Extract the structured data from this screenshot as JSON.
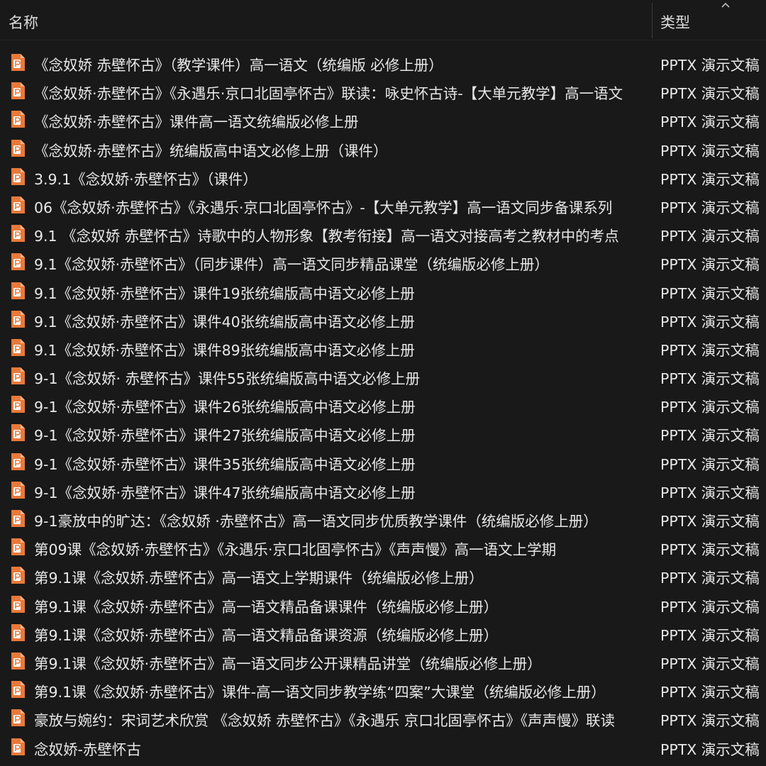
{
  "header": {
    "name_label": "名称",
    "type_label": "类型",
    "sort_icon": "chevron-up-icon"
  },
  "colors": {
    "background": "#191919",
    "text": "#e8e8e8",
    "icon_orange": "#e8793a"
  },
  "files": [
    {
      "name": "《念奴娇 赤壁怀古》（教学课件）高一语文（统编版 必修上册）",
      "type": "PPTX 演示文稿"
    },
    {
      "name": "《念奴娇·赤壁怀古》《永遇乐·京口北固亭怀古》联读：咏史怀古诗-【大单元教学】高一语文",
      "type": "PPTX 演示文稿"
    },
    {
      "name": "《念奴娇·赤壁怀古》课件高一语文统编版必修上册",
      "type": "PPTX 演示文稿"
    },
    {
      "name": "《念奴娇·赤壁怀古》统编版高中语文必修上册（课件）",
      "type": "PPTX 演示文稿"
    },
    {
      "name": "3.9.1《念奴娇·赤壁怀古》（课件）",
      "type": "PPTX 演示文稿"
    },
    {
      "name": "06《念奴娇·赤壁怀古》《永遇乐·京口北固亭怀古》-【大单元教学】高一语文同步备课系列",
      "type": "PPTX 演示文稿"
    },
    {
      "name": "9.1 《念奴娇  赤壁怀古》诗歌中的人物形象【教考衔接】高一语文对接高考之教材中的考点",
      "type": "PPTX 演示文稿"
    },
    {
      "name": "9.1《念奴娇·赤壁怀古》（同步课件）高一语文同步精品课堂（统编版必修上册）",
      "type": "PPTX 演示文稿"
    },
    {
      "name": "9.1《念奴娇·赤壁怀古》课件19张统编版高中语文必修上册",
      "type": "PPTX 演示文稿"
    },
    {
      "name": "9.1《念奴娇·赤壁怀古》课件40张统编版高中语文必修上册",
      "type": "PPTX 演示文稿"
    },
    {
      "name": "9.1《念奴娇·赤壁怀古》课件89张统编版高中语文必修上册",
      "type": "PPTX 演示文稿"
    },
    {
      "name": "9-1《念奴娇· 赤壁怀古》课件55张统编版高中语文必修上册",
      "type": "PPTX 演示文稿"
    },
    {
      "name": "9-1《念奴娇·赤壁怀古》课件26张统编版高中语文必修上册",
      "type": "PPTX 演示文稿"
    },
    {
      "name": "9-1《念奴娇·赤壁怀古》课件27张统编版高中语文必修上册",
      "type": "PPTX 演示文稿"
    },
    {
      "name": "9-1《念奴娇·赤壁怀古》课件35张统编版高中语文必修上册",
      "type": "PPTX 演示文稿"
    },
    {
      "name": "9-1《念奴娇·赤壁怀古》课件47张统编版高中语文必修上册",
      "type": "PPTX 演示文稿"
    },
    {
      "name": "9-1豪放中的旷达：《念奴娇 ·赤壁怀古》高一语文同步优质教学课件（统编版必修上册）",
      "type": "PPTX 演示文稿"
    },
    {
      "name": "第09课《念奴娇·赤壁怀古》《永遇乐·京口北固亭怀古》《声声慢》高一语文上学期",
      "type": "PPTX 演示文稿"
    },
    {
      "name": "第9.1课《念奴娇.赤壁怀古》高一语文上学期课件（统编版必修上册）",
      "type": "PPTX 演示文稿"
    },
    {
      "name": "第9.1课《念奴娇·赤壁怀古》高一语文精品备课课件（统编版必修上册）",
      "type": "PPTX 演示文稿"
    },
    {
      "name": "第9.1课《念奴娇·赤壁怀古》高一语文精品备课资源（统编版必修上册）",
      "type": "PPTX 演示文稿"
    },
    {
      "name": "第9.1课《念奴娇·赤壁怀古》高一语文同步公开课精品讲堂（统编版必修上册）",
      "type": "PPTX 演示文稿"
    },
    {
      "name": "第9.1课《念奴娇·赤壁怀古》课件-高一语文同步教学练“四案”大课堂（统编版必修上册）",
      "type": "PPTX 演示文稿"
    },
    {
      "name": "豪放与婉约：宋词艺术欣赏 《念奴娇  赤壁怀古》《永遇乐 京口北固亭怀古》《声声慢》联读",
      "type": "PPTX 演示文稿"
    },
    {
      "name": "念奴娇-赤壁怀古",
      "type": "PPTX 演示文稿"
    }
  ]
}
